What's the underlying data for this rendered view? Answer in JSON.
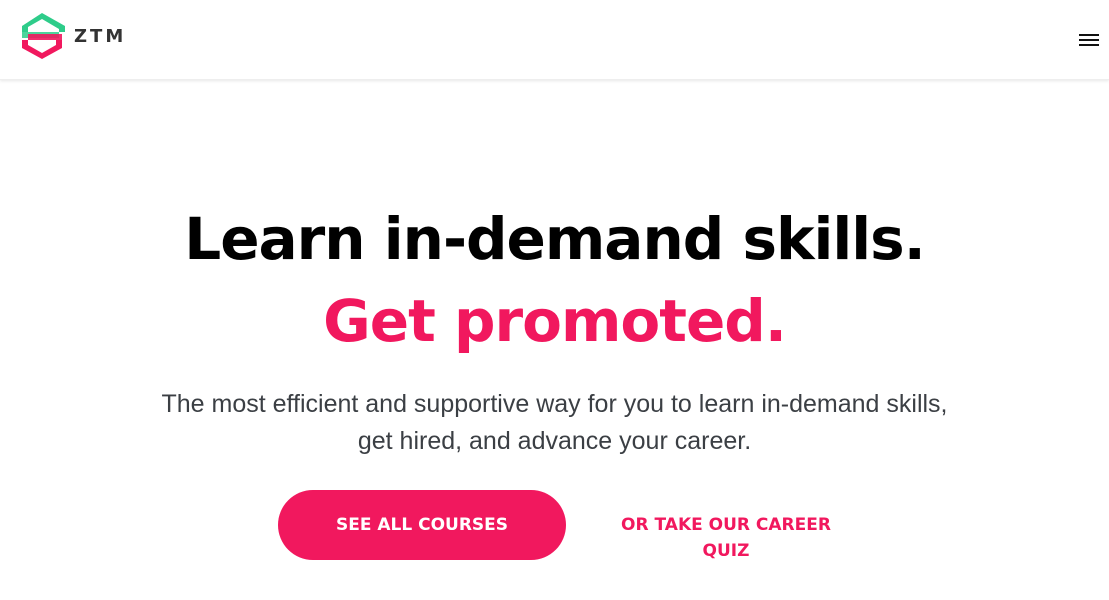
{
  "header": {
    "logo_text": "ZTM",
    "menu_icon": "hamburger-menu-icon"
  },
  "hero": {
    "headline": "Learn in-demand skills.",
    "headline_accent": "Get promoted.",
    "subtext_line1": "The most efficient and supportive way for you to learn in-demand skills,",
    "subtext_line2": "get hired, and advance your career.",
    "primary_cta": "SEE ALL COURSES",
    "secondary_cta": "OR TAKE OUR CAREER QUIZ"
  },
  "colors": {
    "accent": "#f1185e",
    "logo_green": "#2ecc8a",
    "logo_pink": "#f1185e",
    "text_dark": "#000000",
    "text_body": "#3b3f44"
  }
}
